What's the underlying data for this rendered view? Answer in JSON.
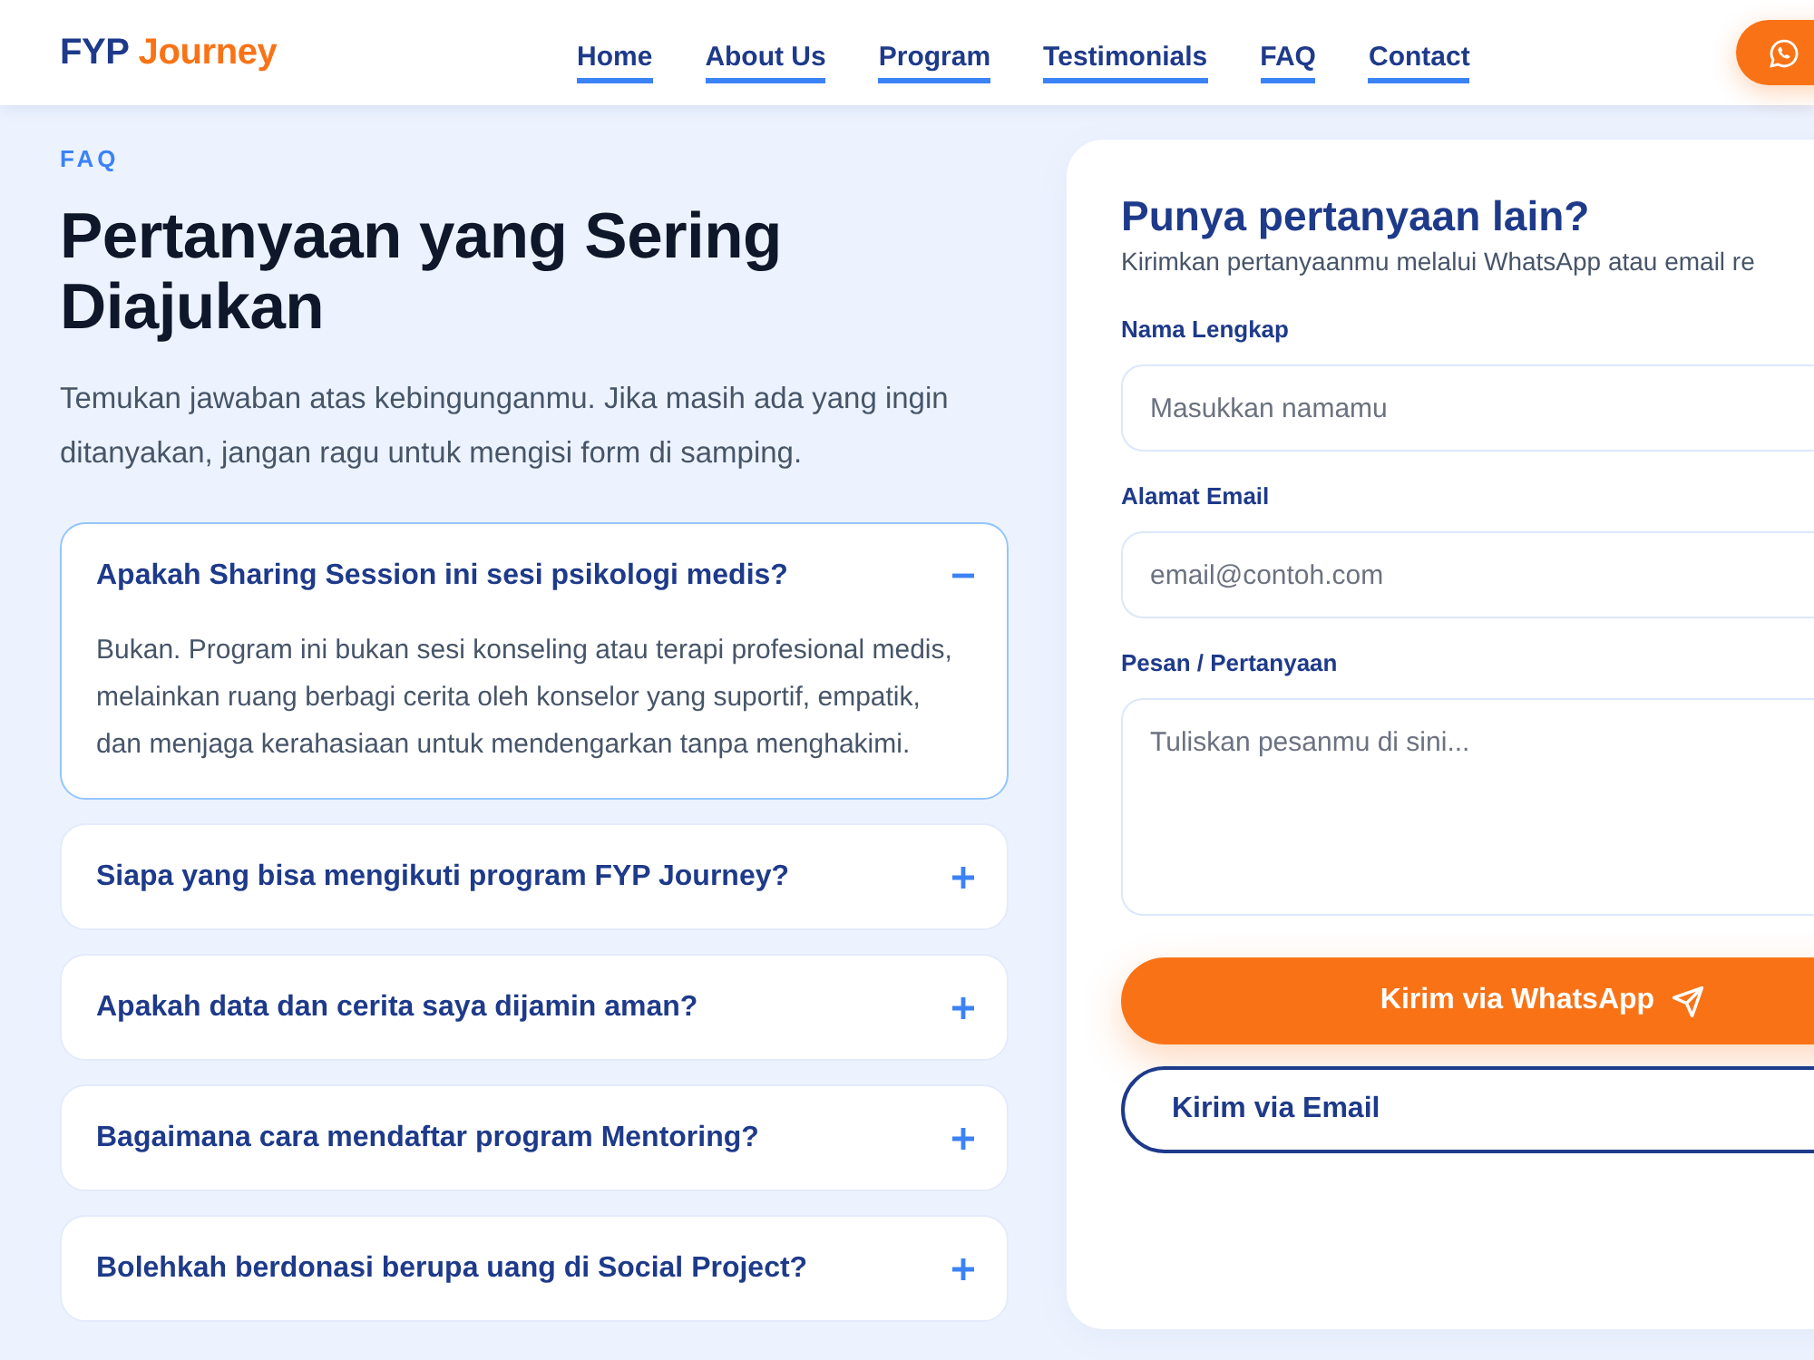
{
  "header": {
    "logo": {
      "part_1": "FYP",
      "part_2": "Journey"
    },
    "nav": [
      "Home",
      "About Us",
      "Program",
      "Testimonials",
      "FAQ",
      "Contact"
    ]
  },
  "faq": {
    "eyebrow": "FAQ",
    "title": "Pertanyaan yang Sering Diajukan",
    "intro": "Temukan jawaban atas kebingunganmu. Jika masih ada yang ingin ditanyakan, jangan ragu untuk mengisi form di samping.",
    "items": [
      {
        "question": "Apakah Sharing Session ini sesi psikologi medis?",
        "expanded": true,
        "answer": "Bukan. Program ini bukan sesi konseling atau terapi profesional medis, melainkan ruang berbagi cerita oleh konselor yang suportif, empatik, dan menjaga kerahasiaan untuk mendengarkan tanpa menghakimi."
      },
      {
        "question": "Siapa yang bisa mengikuti program FYP Journey?",
        "expanded": false
      },
      {
        "question": "Apakah data dan cerita saya dijamin aman?",
        "expanded": false
      },
      {
        "question": "Bagaimana cara mendaftar program Mentoring?",
        "expanded": false
      },
      {
        "question": "Bolehkah berdonasi berupa uang di Social Project?",
        "expanded": false
      }
    ]
  },
  "form": {
    "title": "Punya pertanyaan lain?",
    "subtitle": "Kirimkan pertanyaanmu melalui WhatsApp atau email re",
    "fields": [
      {
        "kind": "input",
        "label": "Nama Lengkap",
        "placeholder": "Masukkan namamu"
      },
      {
        "kind": "input",
        "label": "Alamat Email",
        "placeholder": "email@contoh.com"
      },
      {
        "kind": "textarea",
        "label": "Pesan / Pertanyaan",
        "placeholder": "Tuliskan pesanmu di sini..."
      }
    ],
    "buttons": [
      {
        "kind": "primary",
        "label": "Kirim via WhatsApp"
      },
      {
        "kind": "outline",
        "label": "Kirim via Email"
      }
    ]
  }
}
